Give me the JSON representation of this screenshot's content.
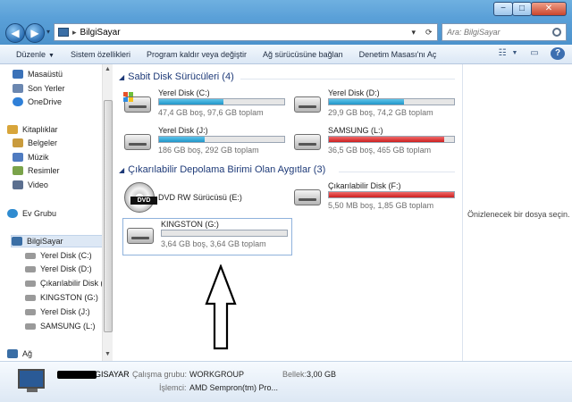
{
  "window": {
    "controls": {
      "minimize": "−",
      "maximize": "□",
      "close": "✕"
    }
  },
  "nav": {
    "back_glyph": "◀",
    "forward_glyph": "▶",
    "history_dropdown": "▾"
  },
  "address": {
    "crumb_separator": "▸",
    "location": "BilgiSayar",
    "dropdown_glyph": "▾",
    "refresh_glyph": "⟳"
  },
  "search": {
    "placeholder": "Ara: BilgiSayar",
    "icon": "search-icon"
  },
  "toolbar": {
    "items": [
      {
        "label": "Düzenle",
        "dropdown": "▼"
      },
      {
        "label": "Sistem özellikleri"
      },
      {
        "label": "Program kaldır veya değiştir"
      },
      {
        "label": "Ağ sürücüsüne bağlan"
      },
      {
        "label": "Denetim Masası'nı Aç"
      }
    ],
    "right_icons": [
      "view-options-icon",
      "preview-pane-icon",
      "help-icon"
    ],
    "view_glyph": "☷",
    "view_dropdown": "▼",
    "preview_glyph": "▭",
    "help_glyph": "?"
  },
  "sidebar": {
    "favorites": [
      {
        "label": "Masaüstü",
        "icon": "desktop-icon",
        "color": "#3b72b8"
      },
      {
        "label": "Son Yerler",
        "icon": "recent-places-icon",
        "color": "#6b87b0"
      },
      {
        "label": "OneDrive",
        "icon": "onedrive-icon",
        "color": "#2f80d8"
      }
    ],
    "libraries": {
      "label": "Kitaplıklar",
      "icon": "libraries-icon",
      "color": "#d8a53a"
    },
    "library_items": [
      {
        "label": "Belgeler",
        "icon": "documents-icon",
        "color": "#c99b3d"
      },
      {
        "label": "Müzik",
        "icon": "music-icon",
        "color": "#4f7bc0"
      },
      {
        "label": "Resimler",
        "icon": "pictures-icon",
        "color": "#7aa34a"
      },
      {
        "label": "Video",
        "icon": "video-icon",
        "color": "#5b6f8f"
      }
    ],
    "homegroup": {
      "label": "Ev Grubu",
      "icon": "homegroup-icon",
      "color": "#2f8bd0"
    },
    "computer": {
      "label": "BilgiSayar",
      "icon": "computer-icon",
      "color": "#3a6ea5"
    },
    "computer_items": [
      {
        "label": "Yerel Disk (C:)",
        "icon": "system-drive-icon",
        "color": "#9a9a9a"
      },
      {
        "label": "Yerel Disk (D:)",
        "icon": "drive-icon",
        "color": "#9a9a9a"
      },
      {
        "label": "Çıkarılabilir Disk (",
        "icon": "removable-drive-icon",
        "color": "#9a9a9a"
      },
      {
        "label": "KINGSTON (G:)",
        "icon": "usb-drive-icon",
        "color": "#9a9a9a"
      },
      {
        "label": "Yerel Disk (J:)",
        "icon": "drive-icon",
        "color": "#9a9a9a"
      },
      {
        "label": "SAMSUNG (L:)",
        "icon": "drive-icon",
        "color": "#9a9a9a"
      }
    ],
    "network": {
      "label": "Ağ",
      "icon": "network-icon",
      "color": "#3a6ea5"
    },
    "scroll_up": "▲",
    "scroll_down": "▼"
  },
  "main": {
    "groups": [
      {
        "title": "Sabit Disk Sürücüleri (4)",
        "chevron": "◢",
        "drives": [
          {
            "name": "Yerel Disk (C:)",
            "info": "47,4 GB boş, 97,6 GB toplam",
            "used_fraction": 0.514,
            "bar_color": "blue",
            "icon": "system-drive-icon"
          },
          {
            "name": "Yerel Disk (D:)",
            "info": "29,9 GB boş, 74,2 GB toplam",
            "used_fraction": 0.597,
            "bar_color": "blue",
            "icon": "drive-icon"
          },
          {
            "name": "Yerel Disk (J:)",
            "info": "186 GB boş, 292 GB toplam",
            "used_fraction": 0.363,
            "bar_color": "blue",
            "icon": "drive-icon"
          },
          {
            "name": "SAMSUNG (L:)",
            "info": "36,5 GB boş, 465 GB toplam",
            "used_fraction": 0.921,
            "bar_color": "red",
            "icon": "drive-icon"
          }
        ]
      },
      {
        "title": "Çıkarılabilir Depolama Birimi Olan Aygıtlar (3)",
        "chevron": "◢",
        "drives": [
          {
            "name": "DVD RW Sürücüsü (E:)",
            "info": "",
            "icon": "dvd-drive-icon",
            "dvd_text": "DVD"
          },
          {
            "name": "Çıkarılabilir Disk (F:)",
            "info": "5,50 MB boş, 1,85 GB toplam",
            "used_fraction": 0.997,
            "bar_color": "red",
            "icon": "removable-drive-icon"
          },
          {
            "name": "KINGSTON (G:)",
            "info": "3,64 GB boş, 3,64 GB toplam",
            "used_fraction": 0.0,
            "bar_color": "blue",
            "icon": "usb-drive-icon",
            "selected": true
          }
        ]
      }
    ]
  },
  "preview": {
    "text": "Önizlenecek bir dosya seçin."
  },
  "details": {
    "computer_name_suffix": "GISAYAR",
    "workgroup_label": "Çalışma grubu:",
    "workgroup_value": "WORKGROUP",
    "memory_label": "Bellek:",
    "memory_value": "3,00 GB",
    "processor_label": "İşlemci:",
    "processor_value": "AMD Sempron(tm) Pro..."
  },
  "colors": {
    "accent": "#1e3a78",
    "bar_blue": "#2196c9",
    "bar_red": "#cc1f1f"
  }
}
